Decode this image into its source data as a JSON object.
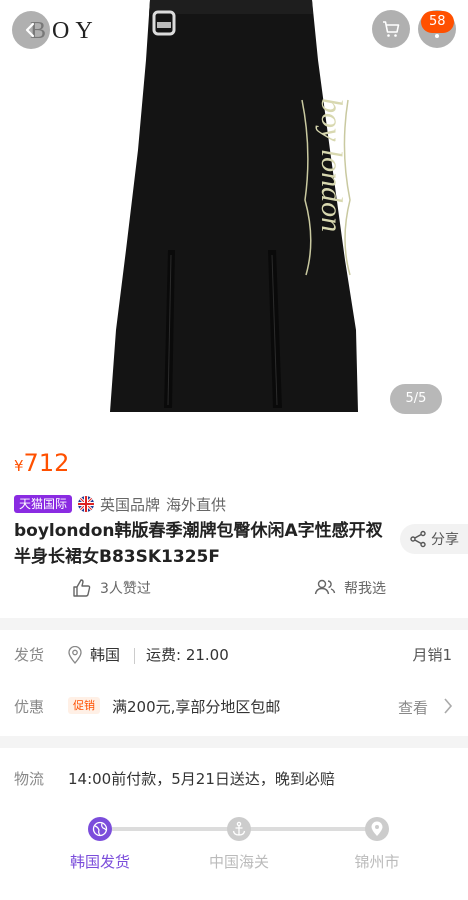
{
  "header": {
    "brand_logo_text": "BOY",
    "cart_badge": "58",
    "image_indicator": "5/5",
    "skirt_print_text": "boy london"
  },
  "product": {
    "price_symbol": "¥",
    "price": "712",
    "store_tag": "天猫国际",
    "brand_origin": "英国品牌",
    "import_type": "海外直供",
    "title": "boylondon韩版春季潮牌包臀休闲A字性感开衩半身长裙女B83SK1325F",
    "share_label": "分享",
    "likes_label": "3人赞过",
    "help_pick_label": "帮我选"
  },
  "shipping": {
    "label": "发货",
    "origin": "韩国",
    "fee": "运费: 21.00",
    "monthly_sales": "月销1"
  },
  "promotion": {
    "label": "优惠",
    "tag": "促销",
    "text": "满200元,享部分地区包邮",
    "view_label": "查看"
  },
  "logistics": {
    "label": "物流",
    "text": "14:00前付款，5月21日送达，晚到必赔",
    "steps": [
      {
        "label": "韩国发货",
        "status": "active"
      },
      {
        "label": "中国海关",
        "status": "pending"
      },
      {
        "label": "锦州市",
        "status": "pending"
      }
    ]
  },
  "colors": {
    "accent": "#ff5000",
    "tmall_purple": "#8a2be2",
    "active_step": "#7b4ddb",
    "inactive_step": "#cccccc"
  },
  "icons": [
    "back-arrow-icon",
    "cart-icon",
    "more-icon",
    "uk-flag-icon",
    "share-icon",
    "thumbs-up-icon",
    "people-icon",
    "location-pin-icon",
    "chevron-right-icon",
    "globe-icon",
    "anchor-icon"
  ]
}
